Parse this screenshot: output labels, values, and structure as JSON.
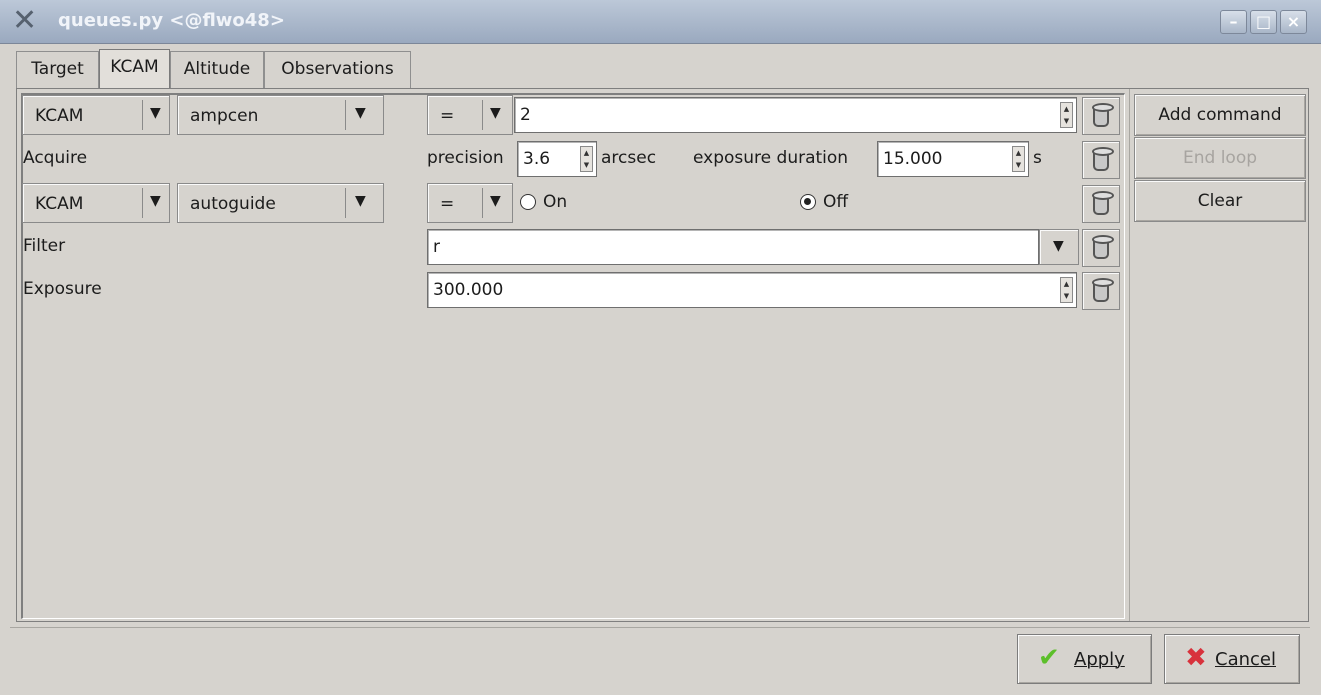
{
  "window": {
    "title": "queues.py <@flwo48>",
    "app_icon": "x-icon",
    "controls": [
      "_",
      "□",
      "×"
    ]
  },
  "tabs": [
    {
      "label": "Target",
      "active": false
    },
    {
      "label": "KCAM",
      "active": true
    },
    {
      "label": "Altitude",
      "active": false
    },
    {
      "label": "Observations",
      "active": false
    }
  ],
  "rows": {
    "r1": {
      "instrument": "KCAM",
      "command": "ampcen",
      "operator": "=",
      "value": "2"
    },
    "r2": {
      "label": "Acquire",
      "precision_label": "precision",
      "precision_value": "3.6",
      "precision_unit": "arcsec",
      "exposure_label": "exposure duration",
      "exposure_value": "15.000",
      "exposure_unit": "s"
    },
    "r3": {
      "instrument": "KCAM",
      "command": "autoguide",
      "operator": "=",
      "on_label": "On",
      "off_label": "Off",
      "selected": "Off"
    },
    "r4": {
      "label": "Filter",
      "value": "r"
    },
    "r5": {
      "label": "Exposure",
      "value": "300.000"
    }
  },
  "side_buttons": {
    "add": "Add command",
    "end_loop": "End loop",
    "clear": "Clear"
  },
  "dialog": {
    "apply": "Apply",
    "cancel": "Cancel",
    "apply_icon": "checkmark-icon",
    "cancel_icon": "cross-icon"
  },
  "colors": {
    "window_bg": "#d6d3ce",
    "titlebar": "#9aa9bf",
    "apply_check": "#5cbf2a",
    "cancel_cross": "#d8323c"
  }
}
